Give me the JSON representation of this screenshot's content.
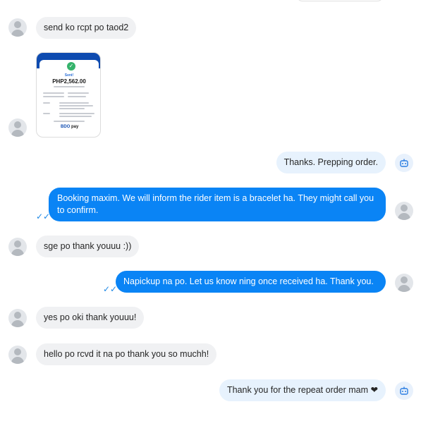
{
  "messages": [
    {
      "text": "send ko rcpt po taod2"
    },
    {
      "receipt": {
        "status": "Sent!",
        "amount": "PHP2,562.00",
        "brand": "BDO",
        "brand_suffix": "pay"
      }
    },
    {
      "text": "Thanks. Prepping order."
    },
    {
      "text": "Booking maxim. We will inform the rider item is a bracelet ha. They might call you to confirm."
    },
    {
      "text": "sge po thank youuu :))"
    },
    {
      "text": "Napickup na po. Let us know ning once received ha. Thank you."
    },
    {
      "text": "yes po oki thank youuu!"
    },
    {
      "text": "hello po rcvd it na po thank you so muchh!"
    },
    {
      "text": "Thank you for the repeat order mam ❤"
    }
  ],
  "colors": {
    "outgoing": "#0a84f5",
    "incoming": "#f0f1f3",
    "outgoing_light": "#e7f2fd",
    "check": "#1e88e5"
  },
  "icons": {
    "avatar": "user-avatar-icon",
    "bot": "bot-icon",
    "read": "double-check-icon"
  },
  "read_mark": "✓✓"
}
